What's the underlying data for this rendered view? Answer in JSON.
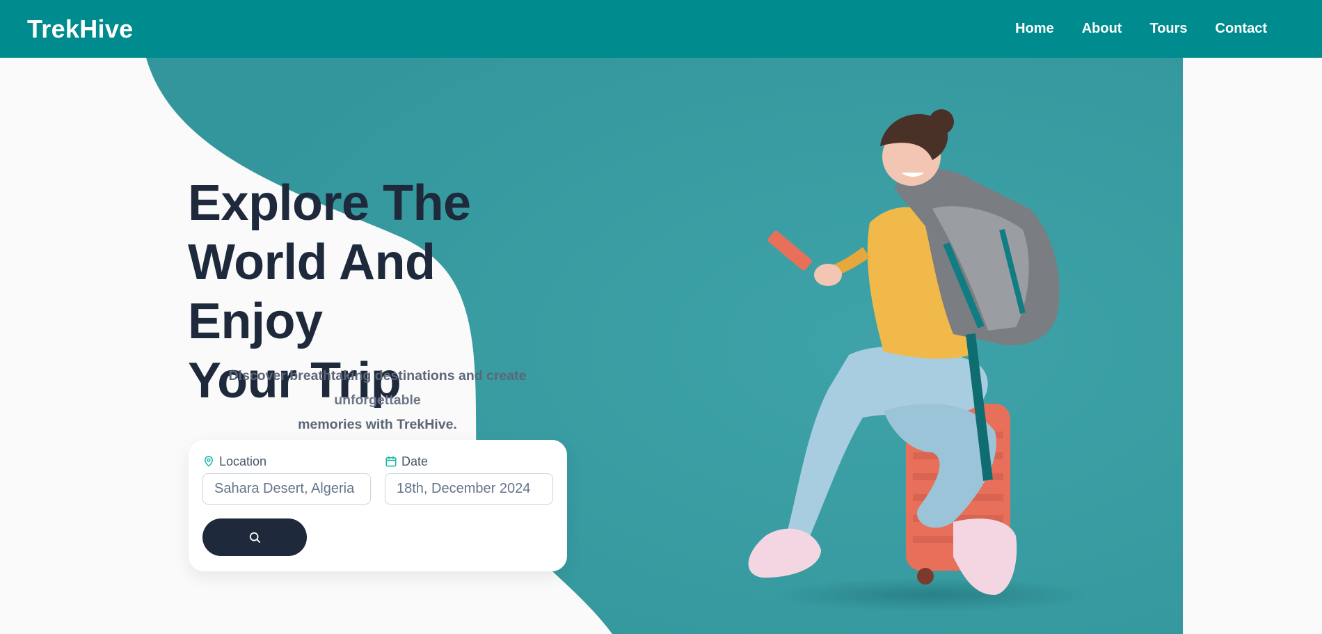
{
  "brand": "TrekHive",
  "nav": {
    "items": [
      "Home",
      "About",
      "Tours",
      "Contact"
    ]
  },
  "hero": {
    "title_lines": [
      "Explore The",
      "World And Enjoy",
      "Your Trip"
    ],
    "subtitle_main": "Discover breathtaking destinations and create ",
    "subtitle_fade": "unforgettable",
    "subtitle_end": "memories with TrekHive."
  },
  "search": {
    "location_label": "Location",
    "location_value": "Sahara Desert, Algeria",
    "date_label": "Date",
    "date_value": "18th, December 2024"
  },
  "colors": {
    "nav": "#008b8e",
    "hero": "#379aa0",
    "dark": "#1e293b",
    "accent": "#14b8a6"
  },
  "icons": [
    "map-pin-icon",
    "calendar-icon",
    "search-icon"
  ]
}
